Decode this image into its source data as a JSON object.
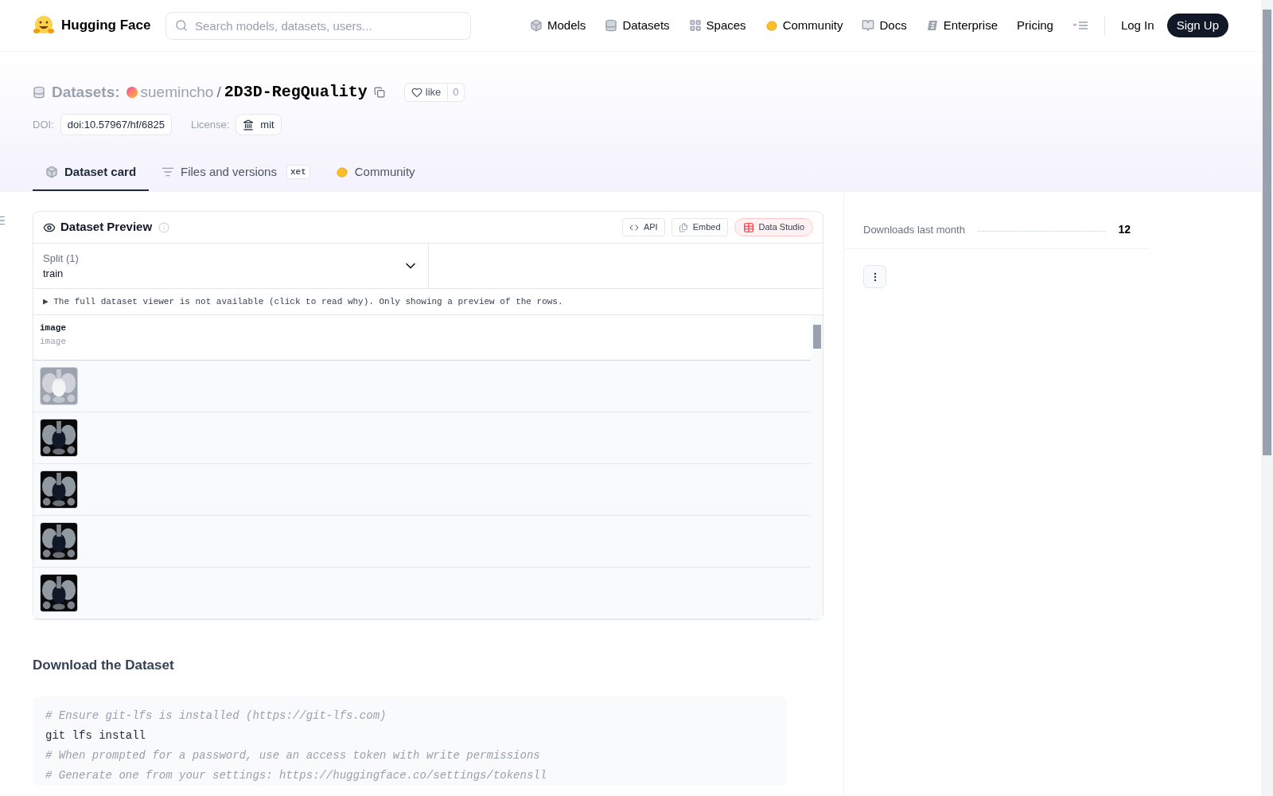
{
  "nav": {
    "brand": "Hugging Face",
    "search": {
      "placeholder": "Search models, datasets, users..."
    },
    "links": [
      {
        "label": "Models"
      },
      {
        "label": "Datasets"
      },
      {
        "label": "Spaces"
      },
      {
        "label": "Community"
      },
      {
        "label": "Docs"
      },
      {
        "label": "Enterprise"
      },
      {
        "label": "Pricing"
      }
    ],
    "login": "Log In",
    "signup": "Sign Up"
  },
  "header": {
    "section": "Datasets:",
    "owner": "suemincho",
    "separator": "/",
    "name": "2D3D-RegQuality",
    "like": {
      "label": "like",
      "count": "0"
    },
    "doi_label": "DOI:",
    "doi": "doi:10.57967/hf/6825",
    "license_label": "License:",
    "license": "mit",
    "tabs": [
      {
        "label": "Dataset card",
        "selected": true
      },
      {
        "label": "Files and versions",
        "badge": "xet",
        "selected": false
      },
      {
        "label": "Community",
        "selected": false
      }
    ]
  },
  "preview": {
    "title": "Dataset Preview",
    "actions": [
      {
        "label": "API",
        "kind": "code"
      },
      {
        "label": "Embed",
        "kind": "embed"
      },
      {
        "label": "Data Studio",
        "kind": "studio"
      }
    ],
    "split": {
      "label": "Split (1)",
      "value": "train"
    },
    "notice_marker": "▶",
    "notice": "The full dataset viewer is not available (click to read why). Only showing a preview of the rows.",
    "column": {
      "name": "image",
      "type": "image"
    }
  },
  "download": {
    "title": "Download the Dataset",
    "code": [
      [
        {
          "text": "# Ensure git-lfs is installed (https://git-lfs.com)",
          "kind": "comment"
        }
      ],
      [
        {
          "text": "git lfs install",
          "kind": "plain"
        }
      ],
      [
        {
          "text": "# When prompted for a password, use an access token with write permissions",
          "kind": "comment"
        }
      ],
      [
        {
          "text": "# Generate one from your settings: https://huggingface.co/settings/tokensll",
          "kind": "comment"
        }
      ]
    ]
  },
  "sidebar": {
    "downloads_label": "Downloads last month",
    "downloads": "12"
  }
}
